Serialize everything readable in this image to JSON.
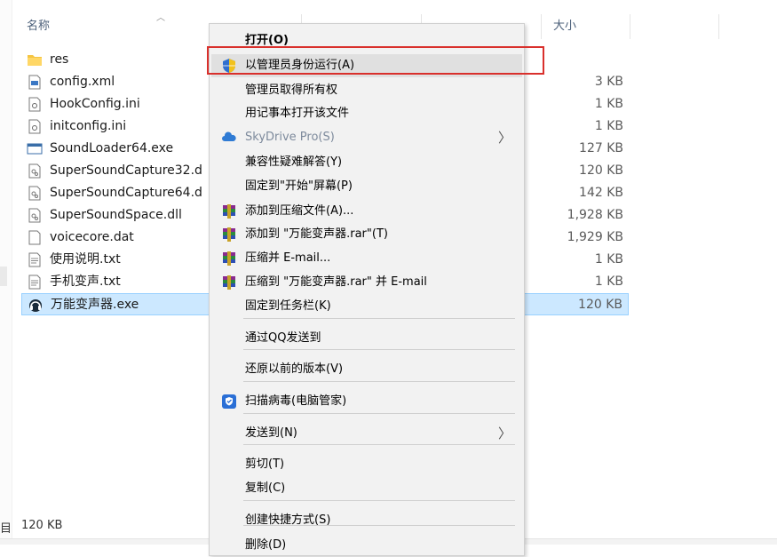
{
  "header": {
    "col_name": "名称",
    "col_size": "大小"
  },
  "files": [
    {
      "name": "res",
      "size": "",
      "icon": "folder-icon"
    },
    {
      "name": "config.xml",
      "size": "3 KB",
      "icon": "xml-file-icon"
    },
    {
      "name": "HookConfig.ini",
      "size": "1 KB",
      "icon": "ini-file-icon"
    },
    {
      "name": "initconfig.ini",
      "size": "1 KB",
      "icon": "ini-file-icon"
    },
    {
      "name": "SoundLoader64.exe",
      "size": "127 KB",
      "icon": "exe-window-icon"
    },
    {
      "name": "SuperSoundCapture32.d",
      "size": "120 KB",
      "icon": "dll-file-icon"
    },
    {
      "name": "SuperSoundCapture64.d",
      "size": "142 KB",
      "icon": "dll-file-icon"
    },
    {
      "name": "SuperSoundSpace.dll",
      "size": "1,928 KB",
      "icon": "dll-file-icon"
    },
    {
      "name": "voicecore.dat",
      "size": "1,929 KB",
      "icon": "blank-file-icon"
    },
    {
      "name": "使用说明.txt",
      "size": "1 KB",
      "icon": "text-file-icon"
    },
    {
      "name": "手机变声.txt",
      "size": "1 KB",
      "icon": "text-file-icon"
    },
    {
      "name": "万能变声器.exe",
      "size": "120 KB",
      "icon": "app-headset-icon",
      "selected": true
    }
  ],
  "status": {
    "count_fragment": "目",
    "selected_size": "120 KB"
  },
  "context_menu": {
    "items": [
      {
        "label": "打开(O)",
        "bold": true
      },
      {
        "label": "以管理员身份运行(A)",
        "icon": "uac-shield-icon",
        "hover": true
      },
      {
        "label": "管理员取得所有权"
      },
      {
        "label": "用记事本打开该文件"
      },
      {
        "label": "SkyDrive Pro(S)",
        "icon": "skydrive-cloud-icon",
        "disabled": true,
        "submenu": true
      },
      {
        "label": "兼容性疑难解答(Y)"
      },
      {
        "label": "固定到\"开始\"屏幕(P)"
      },
      {
        "label": "添加到压缩文件(A)...",
        "icon": "winrar-icon"
      },
      {
        "label": "添加到 \"万能变声器.rar\"(T)",
        "icon": "winrar-icon"
      },
      {
        "label": "压缩并 E-mail...",
        "icon": "winrar-icon"
      },
      {
        "label": "压缩到 \"万能变声器.rar\" 并 E-mail",
        "icon": "winrar-icon"
      },
      {
        "label": "固定到任务栏(K)"
      },
      {
        "label": "通过QQ发送到"
      },
      {
        "label": "还原以前的版本(V)"
      },
      {
        "label": "扫描病毒(电脑管家)",
        "icon": "pc-manager-shield-icon"
      },
      {
        "label": "发送到(N)",
        "submenu": true
      },
      {
        "label": "剪切(T)"
      },
      {
        "label": "复制(C)"
      },
      {
        "label": "创建快捷方式(S)"
      },
      {
        "label": "删除(D)"
      }
    ],
    "chevron_glyph": "〉"
  },
  "colors": {
    "selection_bg": "#cce8ff",
    "highlight_box": "#d9302c",
    "menu_bg": "#f2f2f2"
  }
}
